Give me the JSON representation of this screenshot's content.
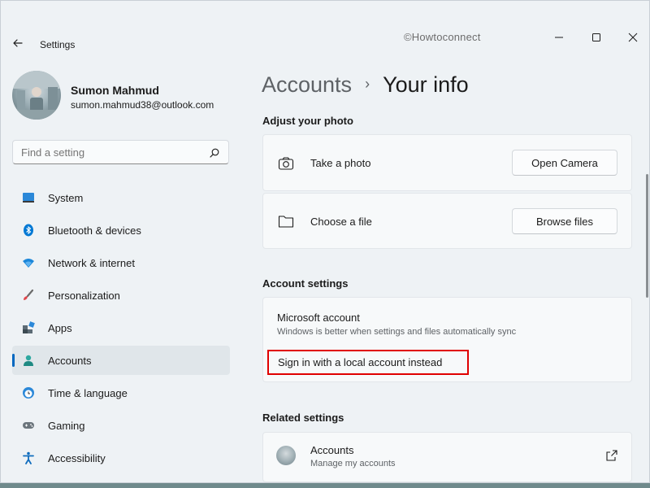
{
  "window": {
    "app_title": "Settings",
    "watermark": "©Howtoconnect"
  },
  "profile": {
    "name": "Sumon Mahmud",
    "email": "sumon.mahmud38@outlook.com"
  },
  "search": {
    "placeholder": "Find a setting"
  },
  "sidebar": {
    "items": [
      {
        "label": "System",
        "icon": "system-icon",
        "active": false
      },
      {
        "label": "Bluetooth & devices",
        "icon": "bluetooth-icon",
        "active": false
      },
      {
        "label": "Network & internet",
        "icon": "wifi-icon",
        "active": false
      },
      {
        "label": "Personalization",
        "icon": "brush-icon",
        "active": false
      },
      {
        "label": "Apps",
        "icon": "apps-icon",
        "active": false
      },
      {
        "label": "Accounts",
        "icon": "person-icon",
        "active": true
      },
      {
        "label": "Time & language",
        "icon": "globe-clock-icon",
        "active": false
      },
      {
        "label": "Gaming",
        "icon": "gamepad-icon",
        "active": false
      },
      {
        "label": "Accessibility",
        "icon": "accessibility-icon",
        "active": false
      }
    ]
  },
  "header": {
    "parent": "Accounts",
    "separator": "›",
    "current": "Your info"
  },
  "photo": {
    "section_title": "Adjust your photo",
    "take_photo_label": "Take a photo",
    "take_photo_button": "Open Camera",
    "choose_file_label": "Choose a file",
    "choose_file_button": "Browse files"
  },
  "account_settings": {
    "section_title": "Account settings",
    "ms_title": "Microsoft account",
    "ms_subtitle": "Windows is better when settings and files automatically sync",
    "local_link": "Sign in with a local account instead"
  },
  "related": {
    "section_title": "Related settings",
    "title": "Accounts",
    "subtitle": "Manage my accounts"
  },
  "colors": {
    "accent": "#0067c0",
    "highlight_box": "#e00000",
    "window_bg": "#eef2f5"
  }
}
